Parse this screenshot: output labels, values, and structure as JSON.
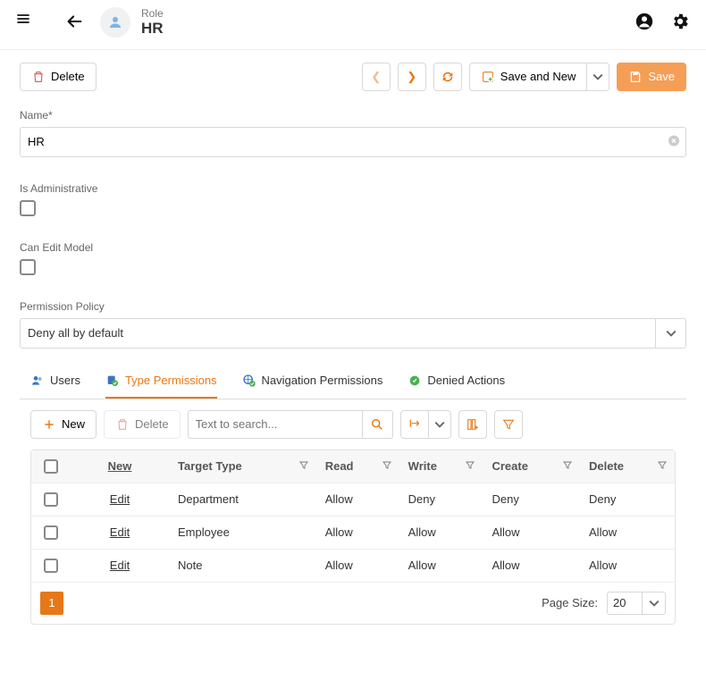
{
  "header": {
    "type_label": "Role",
    "title": "HR"
  },
  "toolbar": {
    "delete": "Delete",
    "save_and_new": "Save and New",
    "save": "Save"
  },
  "form": {
    "name_label": "Name*",
    "name_value": "HR",
    "is_admin_label": "Is Administrative",
    "can_edit_model_label": "Can Edit Model",
    "permission_policy_label": "Permission Policy",
    "permission_policy_value": "Deny all by default"
  },
  "tabs": {
    "users": "Users",
    "type_permissions": "Type Permissions",
    "navigation_permissions": "Navigation Permissions",
    "denied_actions": "Denied Actions"
  },
  "subtoolbar": {
    "new": "New",
    "delete": "Delete",
    "search_placeholder": "Text to search..."
  },
  "table": {
    "header_new": "New",
    "cols": {
      "target_type": "Target Type",
      "read": "Read",
      "write": "Write",
      "create": "Create",
      "delete": "Delete"
    },
    "rows": [
      {
        "action": "Edit",
        "target_type": "Department",
        "read": "Allow",
        "write": "Deny",
        "create": "Deny",
        "delete": "Deny"
      },
      {
        "action": "Edit",
        "target_type": "Employee",
        "read": "Allow",
        "write": "Allow",
        "create": "Allow",
        "delete": "Allow"
      },
      {
        "action": "Edit",
        "target_type": "Note",
        "read": "Allow",
        "write": "Allow",
        "create": "Allow",
        "delete": "Allow"
      }
    ]
  },
  "pager": {
    "current": "1",
    "page_size_label": "Page Size:",
    "page_size": "20"
  },
  "colors": {
    "accent": "#e77817"
  }
}
